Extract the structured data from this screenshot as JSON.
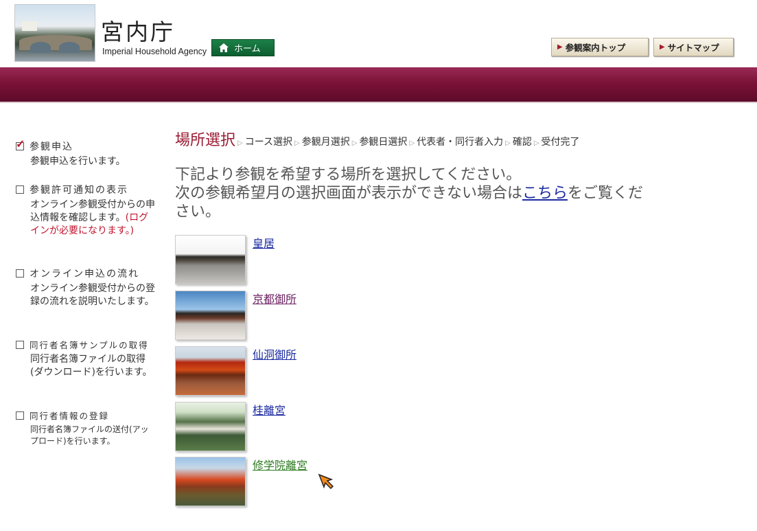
{
  "header": {
    "org_name_ja": "宮内庁",
    "org_name_en": "Imperial Household Agency",
    "home_label": "ホーム",
    "nav_buttons": [
      "参観案内トップ",
      "サイトマップ"
    ],
    "accent_color": "#7a1237"
  },
  "sidebar": {
    "items": [
      {
        "title": "参観申込",
        "desc": "参観申込を行います。",
        "note": "",
        "checked": true
      },
      {
        "title": "参観許可通知の表示",
        "desc": "オンライン参観受付からの申込情報を確認します。",
        "note": "(ログインが必要になります。)",
        "checked": false
      },
      {
        "title": "オンライン申込の流れ",
        "desc": "オンライン参観受付からの登録の流れを説明いたします。",
        "note": "",
        "checked": false
      },
      {
        "title": "同行者名簿サンプルの取得",
        "desc": "同行者名簿ファイルの取得(ダウンロード)を行います。",
        "note": "",
        "checked": false
      },
      {
        "title": "同行者情報の登録",
        "desc": "同行者名簿ファイルの送付(アップロード)を行います。",
        "note": "",
        "checked": false
      }
    ]
  },
  "main": {
    "steps": [
      "場所選択",
      "コース選択",
      "参観月選択",
      "参観日選択",
      "代表者・同行者入力",
      "確認",
      "受付完了"
    ],
    "intro_line1": "下記より参観を希望する場所を選択してください。",
    "intro_line2_before": "次の参観希望月の選択画面が表示ができない場合は",
    "intro_link": "こちら",
    "intro_line2_after": "をご覧ください。",
    "places": [
      {
        "name": "皇居"
      },
      {
        "name": "京都御所"
      },
      {
        "name": "仙洞御所"
      },
      {
        "name": "桂離宮"
      },
      {
        "name": "修学院離宮"
      }
    ]
  }
}
